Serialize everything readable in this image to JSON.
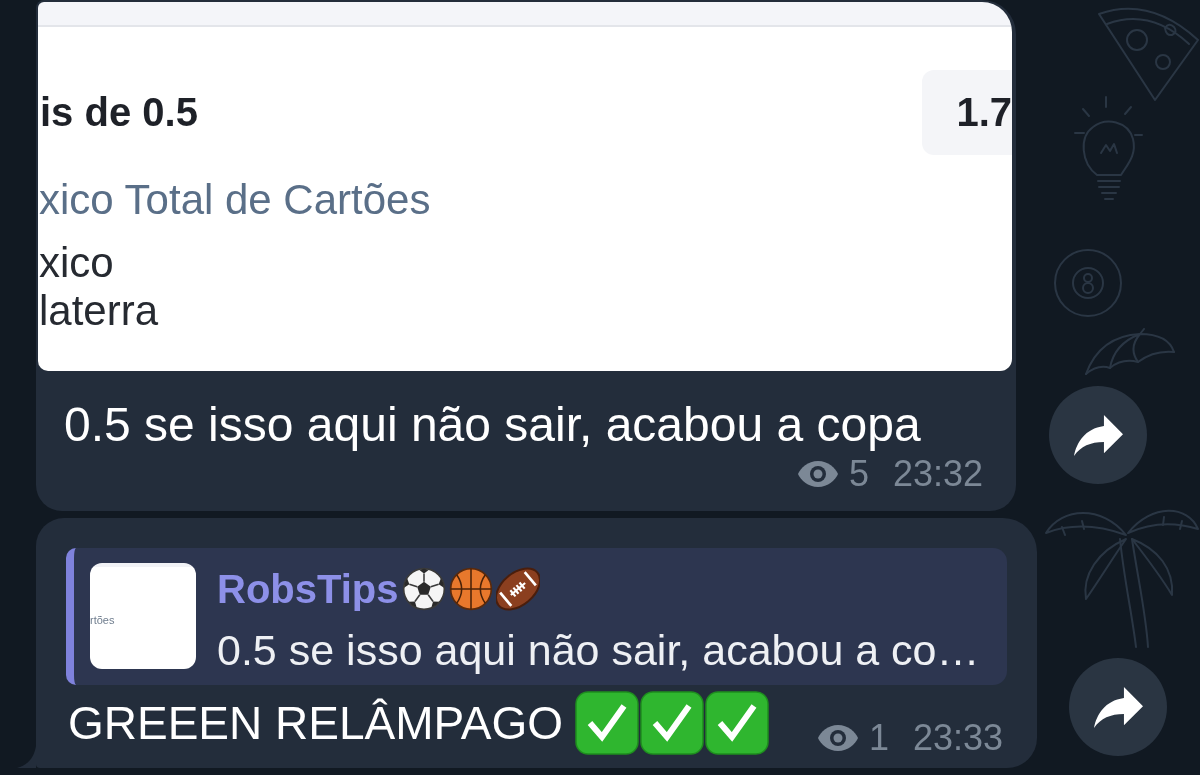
{
  "messages": [
    {
      "kind": "photo",
      "photo": {
        "rows": [
          {
            "kind": "market",
            "text": "is de 0.5",
            "odds": "1.7"
          },
          {
            "kind": "title",
            "text": "xico Total de Cartões"
          },
          {
            "kind": "team",
            "text": "xico"
          },
          {
            "kind": "team",
            "text": "laterra"
          }
        ]
      },
      "text": "0.5 se isso aqui não sair, acabou a copa",
      "views": "5",
      "time": "23:32"
    },
    {
      "kind": "reply",
      "reply": {
        "thumbnail_text": "rtões",
        "author": "RobsTips",
        "author_emojis": [
          {
            "kind": "soccer"
          },
          {
            "kind": "basketball"
          },
          {
            "kind": "football"
          }
        ],
        "text": "0.5 se isso aqui não sair, acabou a co…"
      },
      "text": "GREEEN RELÂMPAGO",
      "emojis": [
        {
          "kind": "check"
        },
        {
          "kind": "check"
        },
        {
          "kind": "check"
        }
      ],
      "views": "1",
      "time": "23:33"
    }
  ]
}
